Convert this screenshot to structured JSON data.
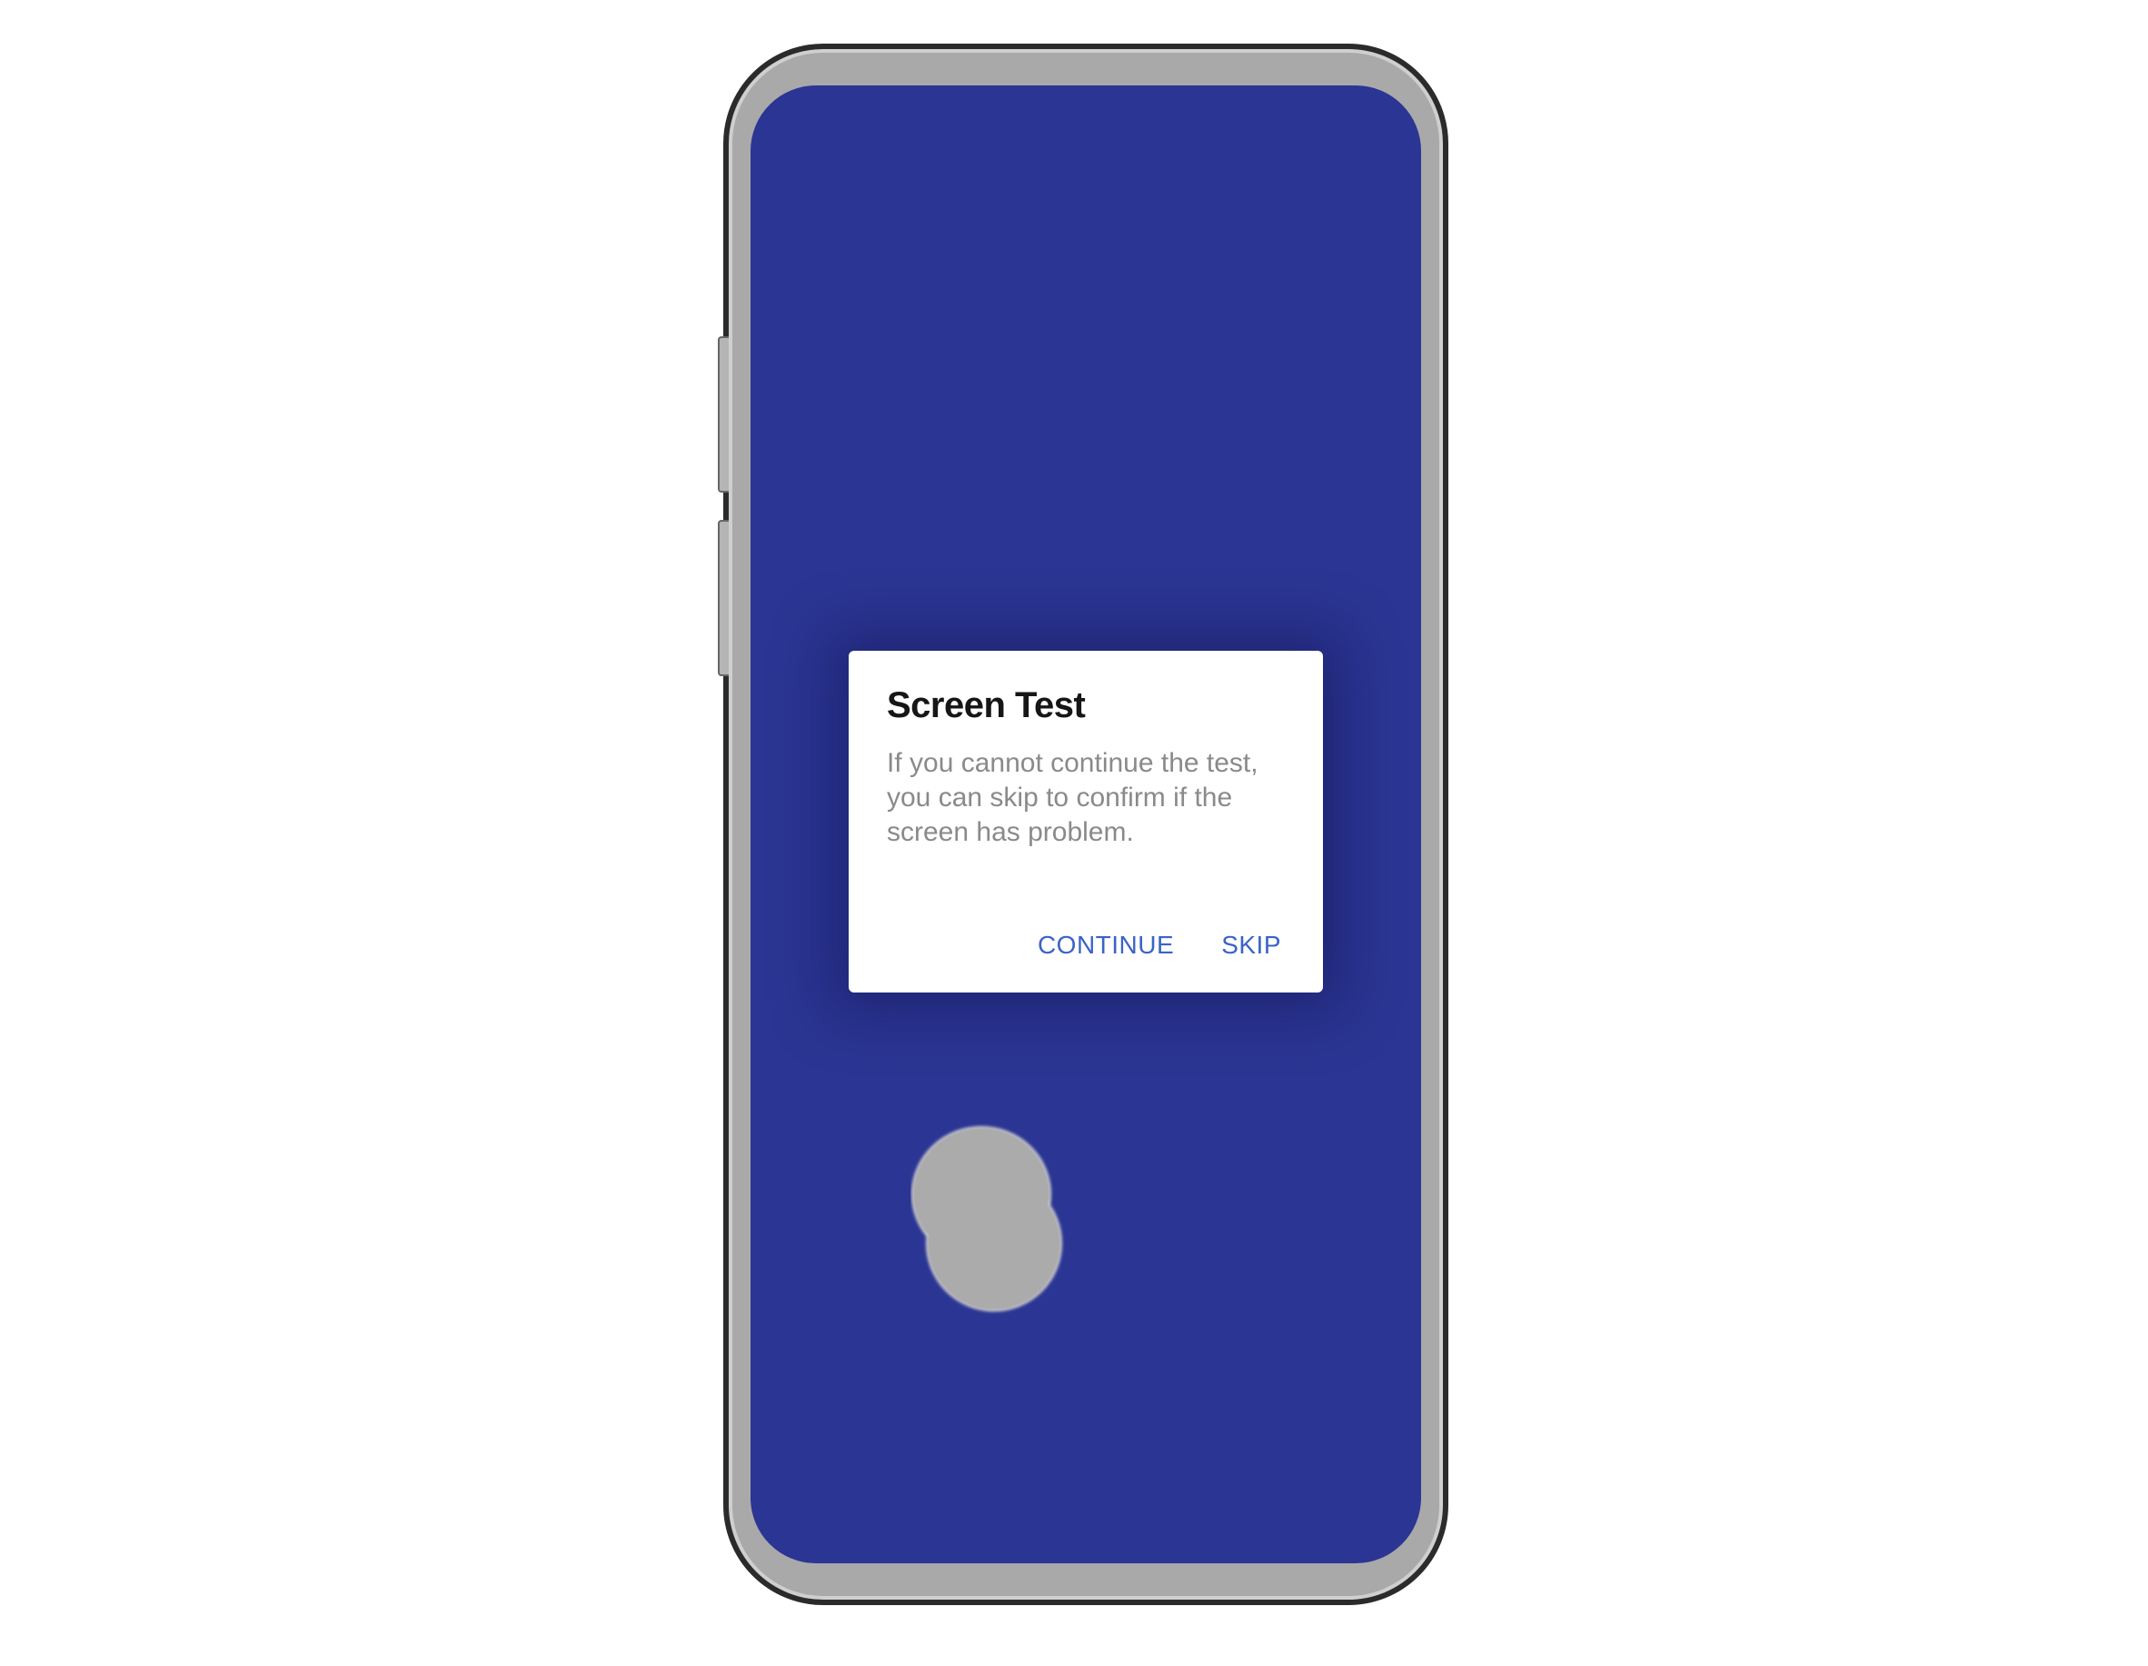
{
  "dialog": {
    "title": "Screen Test",
    "body": "If you cannot continue the test, you can skip to confirm if the screen has problem.",
    "continue_label": "CONTINUE",
    "skip_label": "SKIP"
  },
  "colors": {
    "screen_background": "#2b3593",
    "dialog_background": "#ffffff",
    "button_text": "#3b63c7",
    "touch_mark": "#ababab"
  },
  "icons": {
    "touch_mark": "touch-mark-icon"
  }
}
